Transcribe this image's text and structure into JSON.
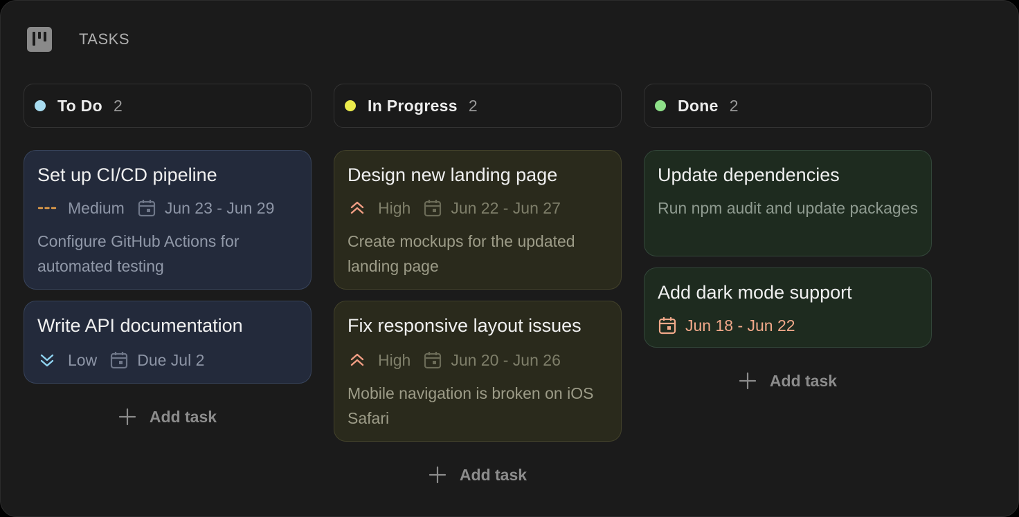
{
  "app": {
    "title": "TASKS",
    "logo_icon": "kanban-board-icon"
  },
  "colors": {
    "todo_dot": "#a8dcf0",
    "in_progress_dot": "#ecec4c",
    "done_dot": "#8ee089",
    "medium_priority": "#e9a24a",
    "high_priority": "#f29e84",
    "low_priority": "#8fd3f0",
    "due_overdue": "#f2a98a"
  },
  "columns": [
    {
      "title": "To Do",
      "count": "2",
      "cards": [
        {
          "title": "Set up CI/CD pipeline",
          "priority": "Medium",
          "priority_icon": "dash-line-icon",
          "dates": "Jun 23 - Jun 29",
          "description": "Configure GitHub Actions for automated testing"
        },
        {
          "title": "Write API documentation",
          "priority": "Low",
          "priority_icon": "double-chevron-down-icon",
          "dates": "Due Jul 2"
        }
      ],
      "add_label": "Add task"
    },
    {
      "title": "In Progress",
      "count": "2",
      "cards": [
        {
          "title": "Design new landing page",
          "priority": "High",
          "priority_icon": "double-chevron-up-icon",
          "dates": "Jun 22 - Jun 27",
          "description": "Create mockups for the updated landing page"
        },
        {
          "title": "Fix responsive layout issues",
          "priority": "High",
          "priority_icon": "double-chevron-up-icon",
          "dates": "Jun 20 - Jun 26",
          "description": "Mobile navigation is broken on iOS Safari"
        }
      ],
      "add_label": "Add task"
    },
    {
      "title": "Done",
      "count": "2",
      "cards": [
        {
          "title": "Update dependencies",
          "description": "Run npm audit and update packages"
        },
        {
          "title": "Add dark mode support",
          "dates": "Jun 18 - Jun 22"
        }
      ],
      "add_label": "Add task"
    }
  ]
}
